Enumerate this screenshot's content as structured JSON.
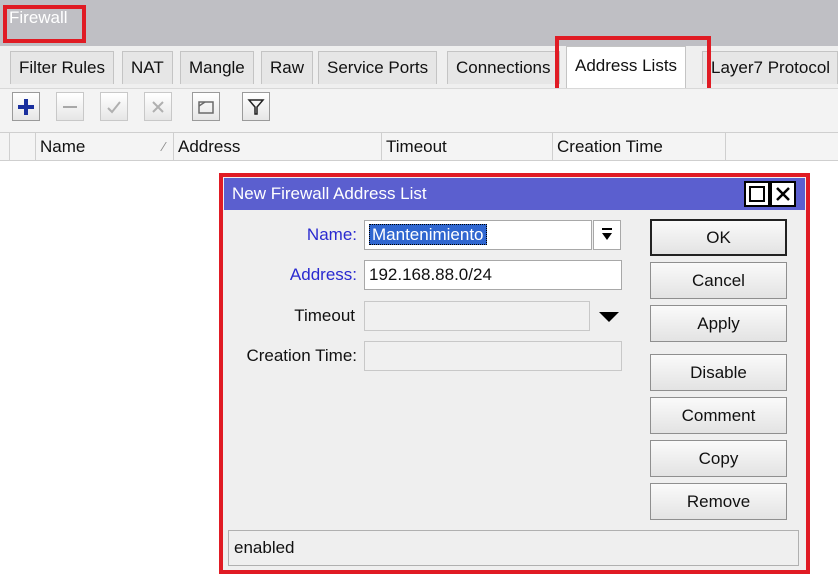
{
  "window": {
    "title": "Firewall"
  },
  "tabs": [
    "Filter Rules",
    "NAT",
    "Mangle",
    "Raw",
    "Service Ports",
    "Connections",
    "Address Lists",
    "Layer7 Protocol"
  ],
  "active_tab": "Address Lists",
  "toolbar": {
    "icons": [
      "add-icon",
      "remove-icon",
      "enable-icon",
      "disable-icon",
      "comment-icon",
      "filter-icon"
    ]
  },
  "table": {
    "columns": [
      "Name",
      "Address",
      "Timeout",
      "Creation Time"
    ]
  },
  "dialog": {
    "title": "New Firewall Address List",
    "fields": {
      "name_label": "Name:",
      "name_value": "Mantenimiento",
      "address_label": "Address:",
      "address_value": "192.168.88.0/24",
      "timeout_label": "Timeout",
      "timeout_value": "",
      "creation_time_label": "Creation Time:",
      "creation_time_value": ""
    },
    "buttons": {
      "ok": "OK",
      "cancel": "Cancel",
      "apply": "Apply",
      "disable": "Disable",
      "comment": "Comment",
      "copy": "Copy",
      "remove": "Remove"
    },
    "status": "enabled"
  },
  "colors": {
    "highlight": "#e01b24",
    "dialog_title": "#5b5fcf",
    "label_blue": "#2a2ad0",
    "selection": "#2f66d0"
  }
}
